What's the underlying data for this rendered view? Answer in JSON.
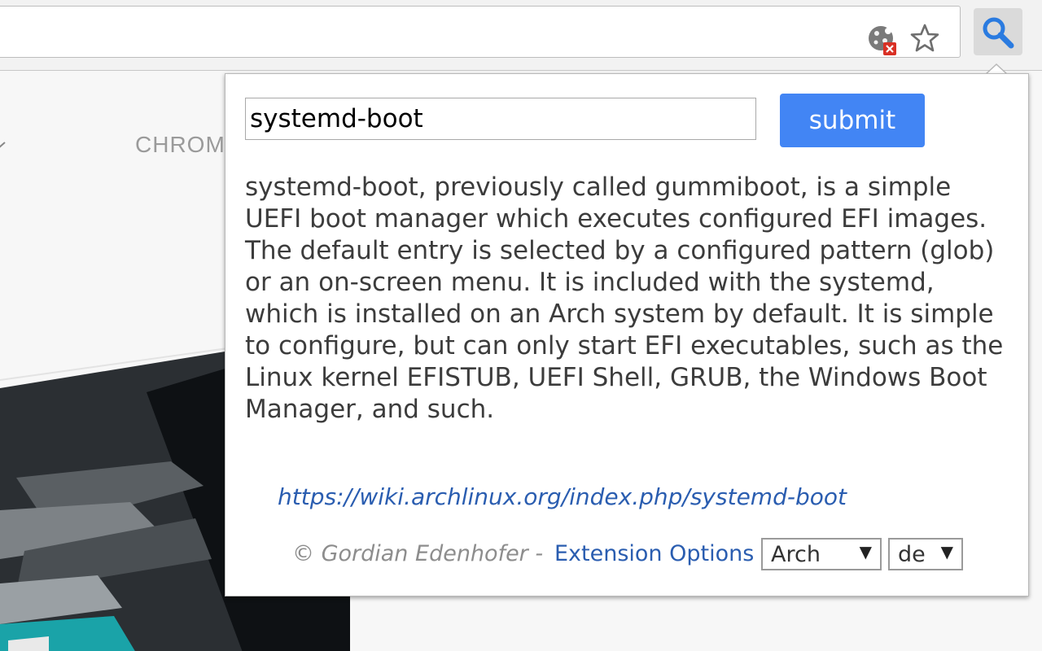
{
  "toolbar": {
    "icons": [
      "cookie-blocked-icon",
      "star-icon",
      "search-extension-icon"
    ],
    "accent": "#4285f4"
  },
  "page": {
    "nav_fragment": "CHROM"
  },
  "popup": {
    "query_value": "systemd-boot",
    "submit_label": "submit",
    "description": "systemd-boot, previously called gummiboot, is a simple UEFI boot manager which executes configured EFI images. The default entry is selected by a configured pattern (glob) or an on-screen menu. It is included with the systemd, which is installed on an Arch system by default. It is simple to configure, but can only start EFI executables, such as the Linux kernel EFISTUB, UEFI Shell, GRUB, the Windows Boot Manager, and such.",
    "link": "https://wiki.archlinux.org/index.php/systemd-boot",
    "footer": {
      "copyright": "© Gordian Edenhofer -",
      "options_label": "Extension Options",
      "source_select": "Arch",
      "language_select": "de"
    },
    "colors": {
      "button": "#4285f4",
      "link": "#2a5db0",
      "text": "#3c3c3c"
    }
  }
}
